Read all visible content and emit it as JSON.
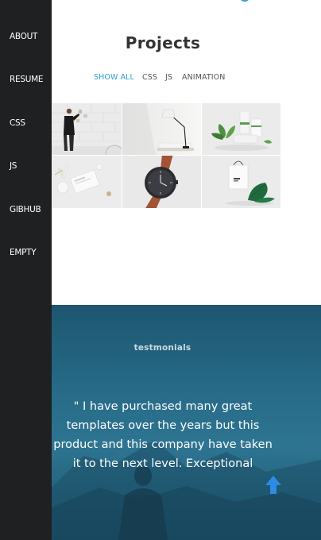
{
  "sidebar": {
    "items": [
      {
        "label": "ABOUT"
      },
      {
        "label": "RESUME"
      },
      {
        "label": "CSS"
      },
      {
        "label": "JS"
      },
      {
        "label": "GIBHUB"
      },
      {
        "label": "EMPTY"
      }
    ]
  },
  "projects": {
    "title": "Projects",
    "filters": [
      {
        "label": "SHOW ALL",
        "active": true
      },
      {
        "label": "CSS"
      },
      {
        "label": "JS"
      },
      {
        "label": "ANIMATION"
      }
    ],
    "items": [
      {
        "icon": "person-at-wall-photo"
      },
      {
        "icon": "desk-lamp-photo"
      },
      {
        "icon": "plant-and-cosmetics-photo"
      },
      {
        "icon": "stationery-flatlay-photo"
      },
      {
        "icon": "wristwatch-photo"
      },
      {
        "icon": "shopping-bag-photo"
      }
    ]
  },
  "testimonials": {
    "label": "testmonials",
    "quote_lines": [
      "\" I have purchased many great",
      "templates over the years but this",
      "product and this company have taken",
      "it to the next level. Exceptional"
    ]
  },
  "colors": {
    "sidebar_bg": "#1f2022",
    "accent": "#2f9fd4",
    "testimonial_bg": "#266a87",
    "scroll_top_button": "#2e8be6"
  }
}
